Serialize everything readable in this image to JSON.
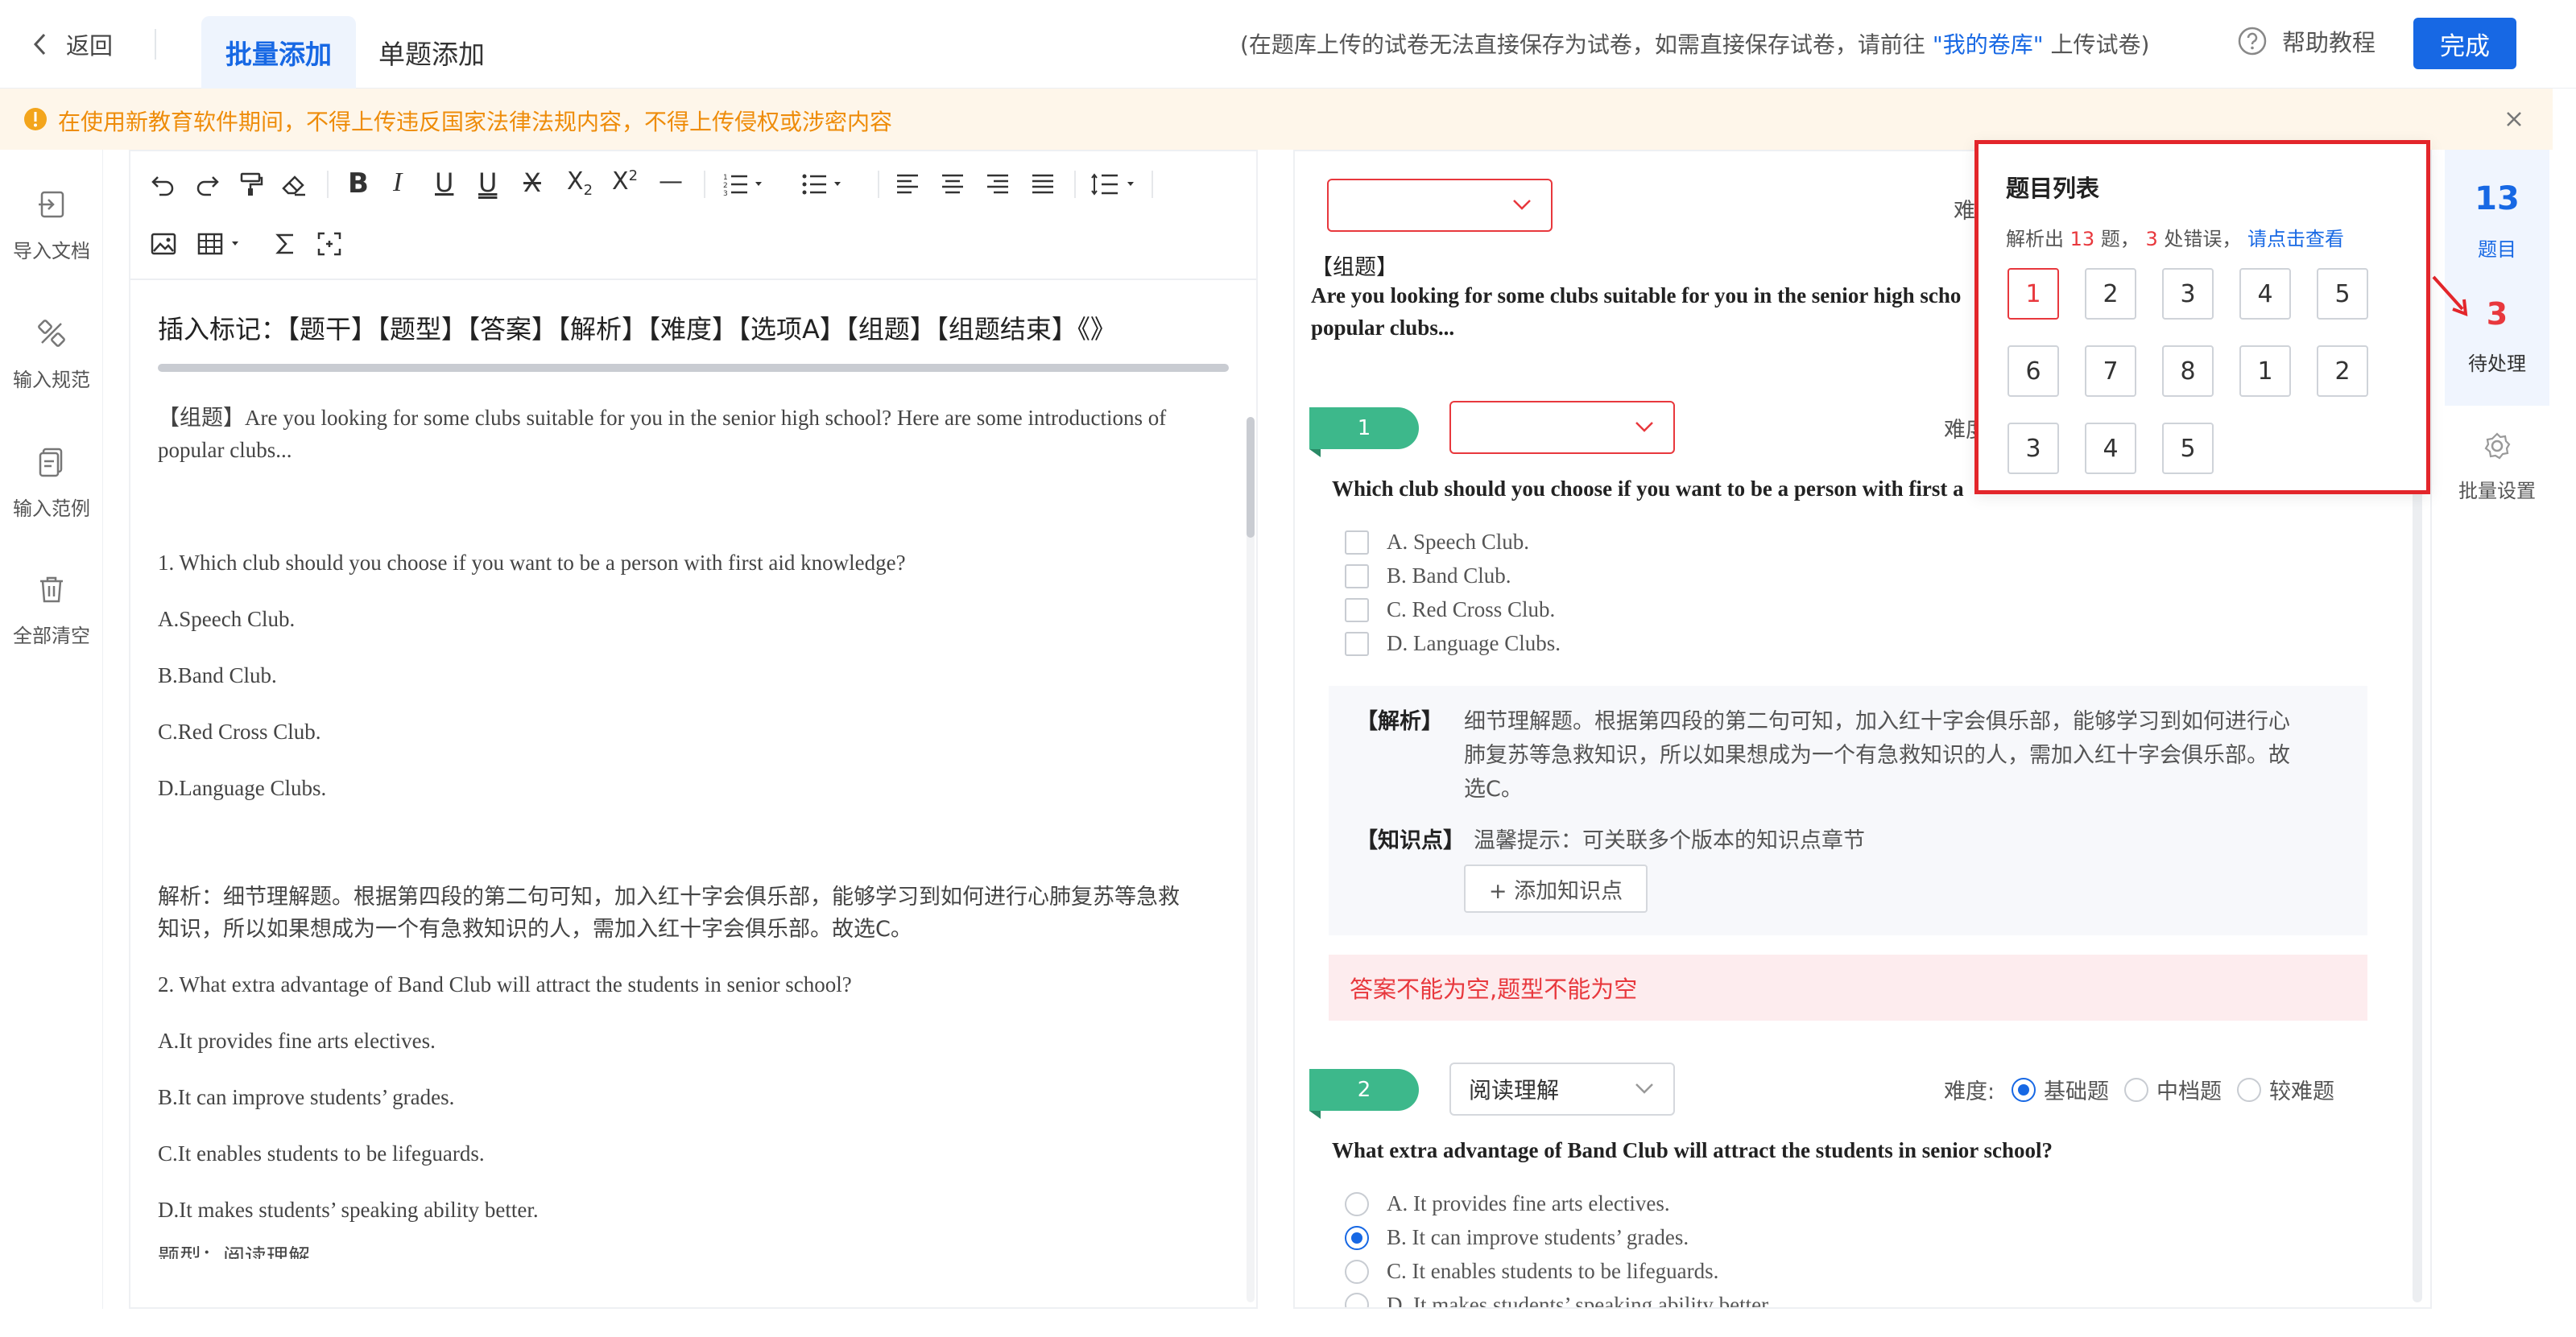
{
  "header": {
    "back_label": "返回",
    "tab_batch": "批量添加",
    "tab_single": "单题添加",
    "notice_prefix": "(在题库上传的试卷无法直接保存为试卷，如需直接保存试卷，请前往 ",
    "notice_link": "\"我的卷库\"",
    "notice_suffix": " 上传试卷)",
    "help_label": "帮助教程",
    "done_label": "完成"
  },
  "warning": {
    "text": "在使用新教育软件期间，不得上传违反国家法律法规内容，不得上传侵权或涉密内容"
  },
  "left_tools": [
    {
      "label": "导入文档",
      "icon": "import-doc-icon"
    },
    {
      "label": "输入规范",
      "icon": "input-rules-icon"
    },
    {
      "label": "输入范例",
      "icon": "input-example-icon"
    },
    {
      "label": "全部清空",
      "icon": "trash-icon"
    }
  ],
  "editor": {
    "markers": "插入标记：【题干】【题型】【答案】【解析】【难度】【选项A】【组题】【组题结束】《》",
    "lines": [
      "【组题】Are you looking for some clubs suitable for you in the senior high school? Here are some introductions of",
      "popular clubs...",
      "1. Which club should you choose if you want to be a person with first aid knowledge?",
      "A.Speech Club.",
      "B.Band Club.",
      "C.Red Cross Club.",
      "D.Language Clubs.",
      "解析：细节理解题。根据第四段的第二句可知，加入红十字会俱乐部，能够学习到如何进行心肺复苏等急救",
      "知识，所以如果想成为一个有急救知识的人，需加入红十字会俱乐部。故选C。",
      "2. What extra advantage of Band Club will attract the students in senior school?",
      "A.It provides fine arts electives.",
      "B.It can improve students’ grades.",
      "C.It enables students to be lifeguards.",
      "D.It makes students’ speaking ability better.",
      "题型：阅读理解"
    ]
  },
  "preview": {
    "difficulty_label_partial": "难",
    "difficulty_label_partial2": "难度",
    "group_tag": "【组题】",
    "group_text_line1": "Are you looking for some clubs suitable for you in the senior high scho",
    "group_text_line2": "popular clubs...",
    "q1": {
      "number": "1",
      "stem": "Which club should you choose if you want to be a person with first a",
      "options": [
        "A. Speech Club.",
        "B. Band Club.",
        "C. Red Cross Club.",
        "D. Language Clubs."
      ],
      "analysis_label": "【解析】",
      "analysis_lines": [
        "细节理解题。根据第四段的第二句可知，加入红十字会俱乐部，能够学习到如何进行心",
        "肺复苏等急救知识，所以如果想成为一个有急救知识的人，需加入红十字会俱乐部。故",
        "选C。"
      ],
      "knowledge_label": "【知识点】",
      "knowledge_hint": "温馨提示：可关联多个版本的知识点章节",
      "add_knowledge": "+ 添加知识点",
      "error": "答案不能为空,题型不能为空"
    },
    "q2": {
      "number": "2",
      "type": "阅读理解",
      "difficulty_label": "难度:",
      "difficulty_options": [
        "基础题",
        "中档题",
        "较难题"
      ],
      "difficulty_selected": 0,
      "stem": "What extra advantage of Band Club will attract the students in senior school?",
      "options": [
        "A. It provides fine arts electives.",
        "B. It can improve students’ grades.",
        "C. It enables students to be lifeguards.",
        "D. It makes students’ speaking ability better."
      ],
      "selected_option": 1
    }
  },
  "popup": {
    "title": "题目列表",
    "summary_prefix": "解析出",
    "summary_count": "13",
    "summary_mid": "题，",
    "summary_errors": "3",
    "summary_suffix": "处错误，",
    "summary_link": "请点击查看",
    "numbers": [
      "1",
      "2",
      "3",
      "4",
      "5",
      "6",
      "7",
      "8",
      "1",
      "2",
      "3",
      "4",
      "5"
    ]
  },
  "right_panel": {
    "count": "13",
    "count_label": "题目",
    "pending": "3",
    "pending_label": "待处理",
    "settings_label": "批量设置"
  },
  "colors": {
    "primary": "#1768e4",
    "error": "#e8383d",
    "warning": "#ee8c0a",
    "green": "#3db88b"
  }
}
